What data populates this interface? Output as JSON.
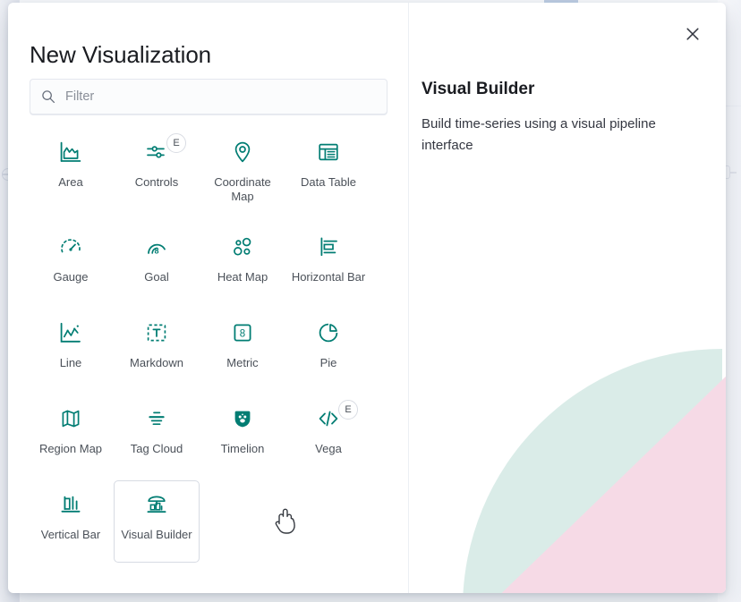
{
  "modal": {
    "title": "New Visualization",
    "close_label": "Close",
    "close_icon": "close-icon"
  },
  "filter": {
    "placeholder": "Filter",
    "value": "",
    "icon": "search-icon"
  },
  "types": [
    {
      "label": "Area",
      "icon": "area-chart-icon",
      "experimental": false,
      "badge": "",
      "selected": false
    },
    {
      "label": "Controls",
      "icon": "controls-sliders-icon",
      "experimental": true,
      "badge": "E",
      "selected": false
    },
    {
      "label": "Coordinate Map",
      "icon": "map-pin-icon",
      "experimental": false,
      "badge": "",
      "selected": false
    },
    {
      "label": "Data Table",
      "icon": "table-icon",
      "experimental": false,
      "badge": "",
      "selected": false
    },
    {
      "label": "Gauge",
      "icon": "gauge-icon",
      "experimental": false,
      "badge": "",
      "selected": false
    },
    {
      "label": "Goal",
      "icon": "goal-icon",
      "experimental": false,
      "badge": "",
      "selected": false
    },
    {
      "label": "Heat Map",
      "icon": "heatmap-dots-icon",
      "experimental": false,
      "badge": "",
      "selected": false
    },
    {
      "label": "Horizontal Bar",
      "icon": "horizontal-bar-icon",
      "experimental": false,
      "badge": "",
      "selected": false
    },
    {
      "label": "Line",
      "icon": "line-chart-icon",
      "experimental": false,
      "badge": "",
      "selected": false
    },
    {
      "label": "Markdown",
      "icon": "markdown-text-icon",
      "experimental": false,
      "badge": "",
      "selected": false
    },
    {
      "label": "Metric",
      "icon": "metric-number-icon",
      "experimental": false,
      "badge": "",
      "selected": false
    },
    {
      "label": "Pie",
      "icon": "pie-chart-icon",
      "experimental": false,
      "badge": "",
      "selected": false
    },
    {
      "label": "Region Map",
      "icon": "region-map-icon",
      "experimental": false,
      "badge": "",
      "selected": false
    },
    {
      "label": "Tag Cloud",
      "icon": "tag-cloud-icon",
      "experimental": false,
      "badge": "",
      "selected": false
    },
    {
      "label": "Timelion",
      "icon": "timelion-bear-icon",
      "experimental": false,
      "badge": "",
      "selected": false
    },
    {
      "label": "Vega",
      "icon": "vega-code-icon",
      "experimental": true,
      "badge": "E",
      "selected": false
    },
    {
      "label": "Vertical Bar",
      "icon": "vertical-bar-icon",
      "experimental": false,
      "badge": "",
      "selected": false
    },
    {
      "label": "Visual Builder",
      "icon": "visual-builder-icon",
      "experimental": false,
      "badge": "",
      "selected": true
    }
  ],
  "detail": {
    "title": "Visual Builder",
    "description": "Build time-series using a visual pipeline interface"
  },
  "colors": {
    "accent_teal": "#017d73",
    "text_primary": "#1a1c21",
    "text_muted": "#4b5159",
    "deco_pink": "#f6dae6",
    "deco_mint": "#cbe4de",
    "border": "#d7dbe3"
  },
  "cursor": {
    "type": "pointer-hand-cursor"
  }
}
